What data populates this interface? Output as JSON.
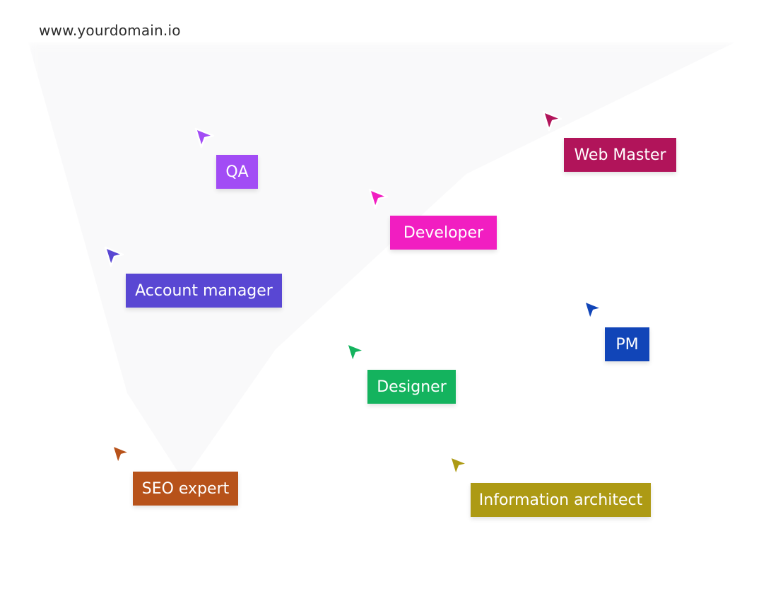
{
  "site": {
    "url": "www.yourdomain.io"
  },
  "roles": [
    {
      "label": "QA",
      "color": "#a24cf5",
      "icon": "cursor-arrow-icon"
    },
    {
      "label": "Web Master",
      "color": "#b1145a",
      "icon": "cursor-arrow-icon"
    },
    {
      "label": "Developer",
      "color": "#f11ec1",
      "icon": "cursor-arrow-icon"
    },
    {
      "label": "Account manager",
      "color": "#5947d3",
      "icon": "cursor-arrow-icon"
    },
    {
      "label": "PM",
      "color": "#1145b8",
      "icon": "cursor-arrow-icon"
    },
    {
      "label": "Designer",
      "color": "#14b35e",
      "icon": "cursor-arrow-icon"
    },
    {
      "label": "SEO expert",
      "color": "#b7521a",
      "icon": "cursor-arrow-icon"
    },
    {
      "label": "Information architect",
      "color": "#ad9a14",
      "icon": "cursor-arrow-icon"
    }
  ]
}
